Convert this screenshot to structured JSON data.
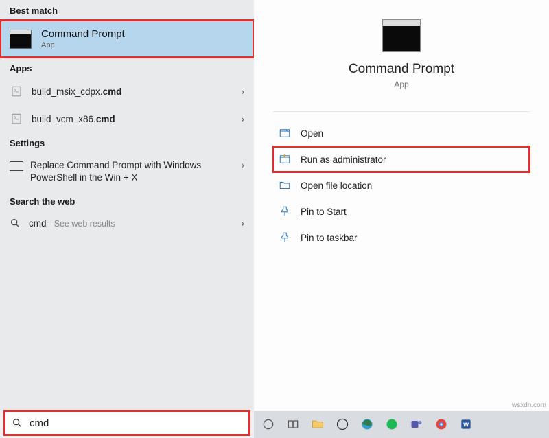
{
  "sections": {
    "bestMatchHeader": "Best match",
    "appsHeader": "Apps",
    "settingsHeader": "Settings",
    "webHeader": "Search the web"
  },
  "bestMatch": {
    "title": "Command Prompt",
    "subtitle": "App"
  },
  "apps": [
    {
      "prefix": "build_msix_cdpx.",
      "bold": "cmd"
    },
    {
      "prefix": "build_vcm_x86.",
      "bold": "cmd"
    }
  ],
  "settings": {
    "text": "Replace Command Prompt with Windows PowerShell in the Win + X"
  },
  "web": {
    "query": "cmd",
    "hint": " - See web results"
  },
  "detail": {
    "title": "Command Prompt",
    "subtitle": "App",
    "actions": {
      "open": "Open",
      "runAdmin": "Run as administrator",
      "openLoc": "Open file location",
      "pinStart": "Pin to Start",
      "pinTaskbar": "Pin to taskbar"
    }
  },
  "search": {
    "value": "cmd"
  },
  "watermark": "wsxdn.com"
}
